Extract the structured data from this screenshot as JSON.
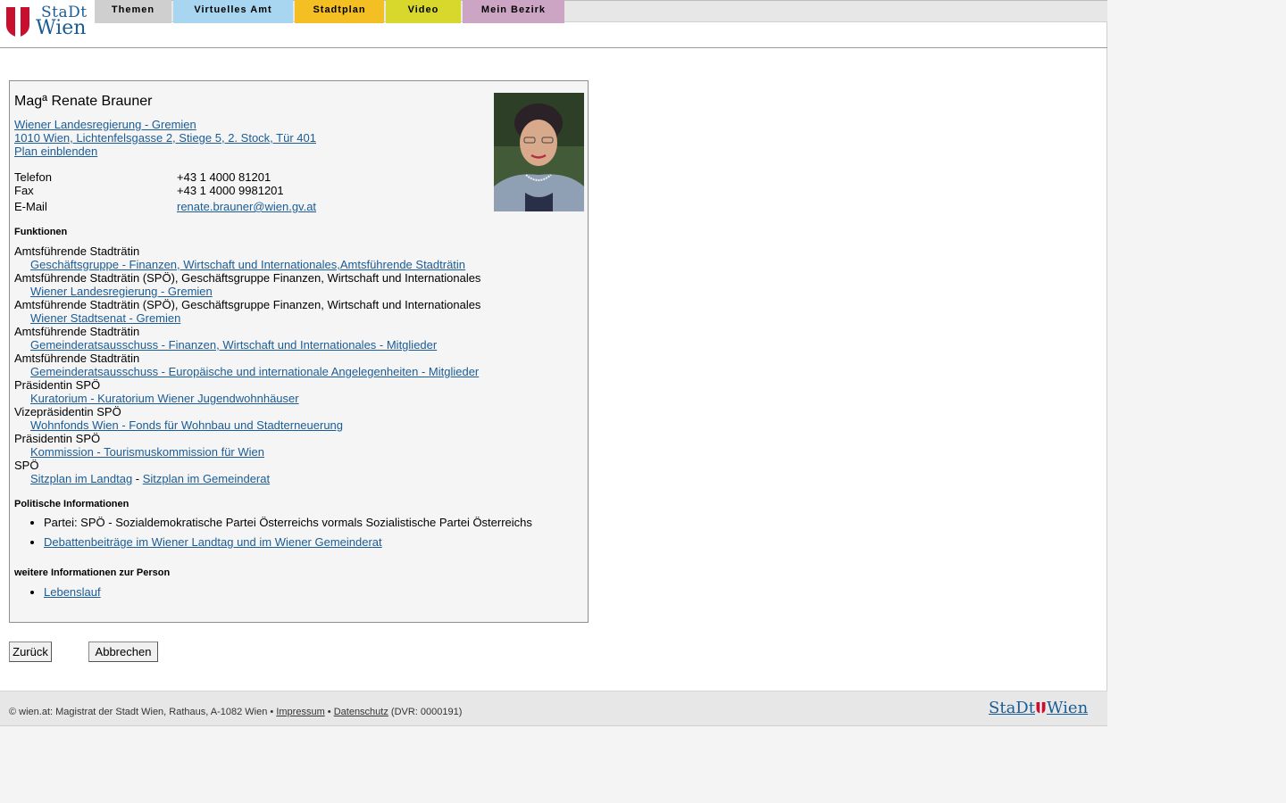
{
  "logo": {
    "top": "StaDt",
    "bottom": "Wien",
    "red": "#c8102e"
  },
  "nav": {
    "tabs": [
      {
        "label": "Themen",
        "color": "#cfcfcf"
      },
      {
        "label": "Virtuelles Amt",
        "color": "#a8d6f0"
      },
      {
        "label": "Stadtplan",
        "color": "#f4bf22"
      },
      {
        "label": "Video",
        "color": "#d8d82c"
      },
      {
        "label": "Mein Bezirk",
        "color": "#cda5c4"
      }
    ]
  },
  "person": {
    "name": "Magª Renate Brauner",
    "org_link": "Wiener Landesregierung - Gremien ",
    "address_link": "1010 Wien, Lichtenfelsgasse 2, Stiege 5, 2. Stock, Tür 401",
    "map_link": "Plan einblenden",
    "contact": [
      {
        "label": "Telefon",
        "value": "+43 1 4000 81201"
      },
      {
        "label": "Fax",
        "value": "+43 1 4000 9981201"
      },
      {
        "label": "E-Mail",
        "value": "renate.brauner@wien.gv.at"
      }
    ]
  },
  "functions": {
    "title": "Funktionen",
    "items": [
      {
        "role": "Amtsführende Stadträtin",
        "link": "Geschäftsgruppe - Finanzen, Wirtschaft und Internationales,Amtsführende Stadträtin"
      },
      {
        "role": "Amtsführende Stadträtin (SPÖ), Geschäftsgruppe Finanzen, Wirtschaft und Internationales",
        "link": "Wiener Landesregierung - Gremien"
      },
      {
        "role": "Amtsführende Stadträtin (SPÖ), Geschäftsgruppe Finanzen, Wirtschaft und Internationales",
        "link": "Wiener Stadtsenat - Gremien"
      },
      {
        "role": "Amtsführende Stadträtin",
        "link": "Gemeinderatsausschuss - Finanzen, Wirtschaft und Internationales - Mitglieder"
      },
      {
        "role": "Amtsführende Stadträtin",
        "link": "Gemeinderatsausschuss - Europäische und internationale Angelegenheiten - Mitglieder"
      },
      {
        "role": "Präsidentin SPÖ",
        "link": "Kuratorium - Kuratorium Wiener Jugendwohnhäuser"
      },
      {
        "role": "Vizepräsidentin SPÖ",
        "link": "Wohnfonds Wien - Fonds für Wohnbau und Stadterneuerung"
      },
      {
        "role": "Präsidentin SPÖ",
        "link": "Kommission - Tourismuskommission für Wien"
      }
    ],
    "last_role": "SPÖ",
    "seat_landtag": "Sitzplan im Landtag",
    "separator": " - ",
    "seat_gemeinderat": "Sitzplan im Gemeinderat"
  },
  "political": {
    "title": "Politische Informationen",
    "party": "Partei: SPÖ - Sozialdemokratische Partei Österreichs vormals Sozialistische Partei Österreichs",
    "debate_link": "Debattenbeiträge im Wiener Landtag und im Wiener Gemeinderat"
  },
  "more": {
    "title": "weitere Informationen zur Person",
    "cv_link": "Lebenslauf"
  },
  "buttons": {
    "back": "Zurück",
    "cancel": "Abbrechen"
  },
  "footer": {
    "prefix": "© wien.at: Magistrat der Stadt Wien, Rathaus, A-1082 Wien • ",
    "impressum": "Impressum",
    "bullet": " • ",
    "privacy": "Datenschutz",
    "suffix": " (DVR: 0000191)",
    "logo_left": "StaDt",
    "logo_right": "Wien"
  }
}
